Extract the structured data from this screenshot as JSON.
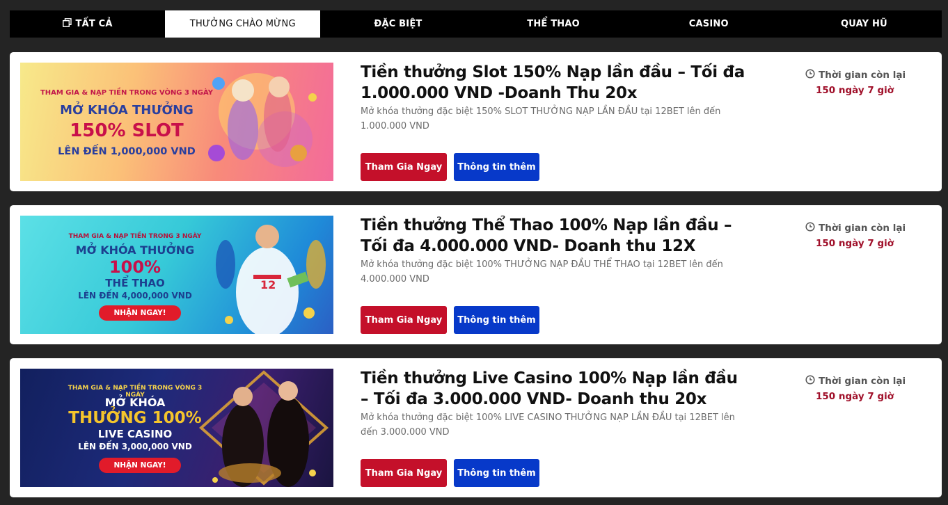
{
  "tabs": [
    {
      "label": "TẤT CẢ",
      "icon": "copy-icon"
    },
    {
      "label": "THƯỞNG CHÀO MỪNG",
      "active": true
    },
    {
      "label": "ĐẶC BIỆT"
    },
    {
      "label": "THỂ THAO"
    },
    {
      "label": "CASINO"
    },
    {
      "label": "QUAY HŨ"
    }
  ],
  "promos": [
    {
      "title": "Tiền thưởng Slot 150% Nạp lần đầu – Tối đa 1.000.000 VND -Doanh Thu 20x",
      "description": "Mở khóa thưởng đặc biệt 150% SLOT THƯỞNG NẠP LẦN ĐẦU tại 12BET lên đến 1.000.000 VND",
      "join_label": "Tham Gia Ngay",
      "info_label": "Thông tin thêm",
      "timer_label": "Thời gian còn lại",
      "timer_value": "150 ngày 7 giờ",
      "banner": {
        "line1": "THAM GIA & NẠP TIỀN TRONG VÒNG 3 NGÀY",
        "line2": "MỞ KHÓA THƯỞNG",
        "line3": "150% SLOT",
        "line4": "LÊN ĐẾN 1,000,000 VND"
      }
    },
    {
      "title": "Tiền thưởng Thể Thao 100% Nạp lần đầu – Tối đa 4.000.000 VND- Doanh thu 12X",
      "description": "Mở khóa thưởng đặc biệt 100% THƯỞNG NẠP ĐẦU THỂ THAO tại 12BET lên đến 4.000.000 VND",
      "join_label": "Tham Gia Ngay",
      "info_label": "Thông tin thêm",
      "timer_label": "Thời gian còn lại",
      "timer_value": "150 ngày 7 giờ",
      "banner": {
        "line1": "THAM GIA & NẠP TIỀN TRONG 3 NGÀY",
        "line2": "MỞ KHÓA THƯỞNG",
        "line3": "100%",
        "line4": "THỂ THAO",
        "line5": "LÊN ĐẾN 4,000,000 VND",
        "cta": "NHẬN NGAY!"
      }
    },
    {
      "title": "Tiền thưởng Live Casino 100% Nạp lần đầu – Tối đa 3.000.000 VND- Doanh thu 20x",
      "description": "Mở khóa thưởng đặc biệt 100% LIVE CASINO THƯỞNG NẠP LẦN ĐẦU tại 12BET lên đến 3.000.000 VND",
      "join_label": "Tham Gia Ngay",
      "info_label": "Thông tin thêm",
      "timer_label": "Thời gian còn lại",
      "timer_value": "150 ngày 7 giờ",
      "banner": {
        "line1": "THAM GIA & NẠP TIỀN TRONG VÒNG 3 NGÀY",
        "line2": "MỞ KHÓA",
        "line3": "THƯỞNG 100%",
        "line4": "LIVE CASINO",
        "line5": "LÊN ĐẾN 3,000,000 VND",
        "cta": "NHẬN NGAY!"
      }
    }
  ],
  "colors": {
    "page_bg": "#242424",
    "tab_bar_bg": "#000000",
    "join_button": "#c4102a",
    "info_button": "#0739c9",
    "timer_value": "#a0102a"
  }
}
